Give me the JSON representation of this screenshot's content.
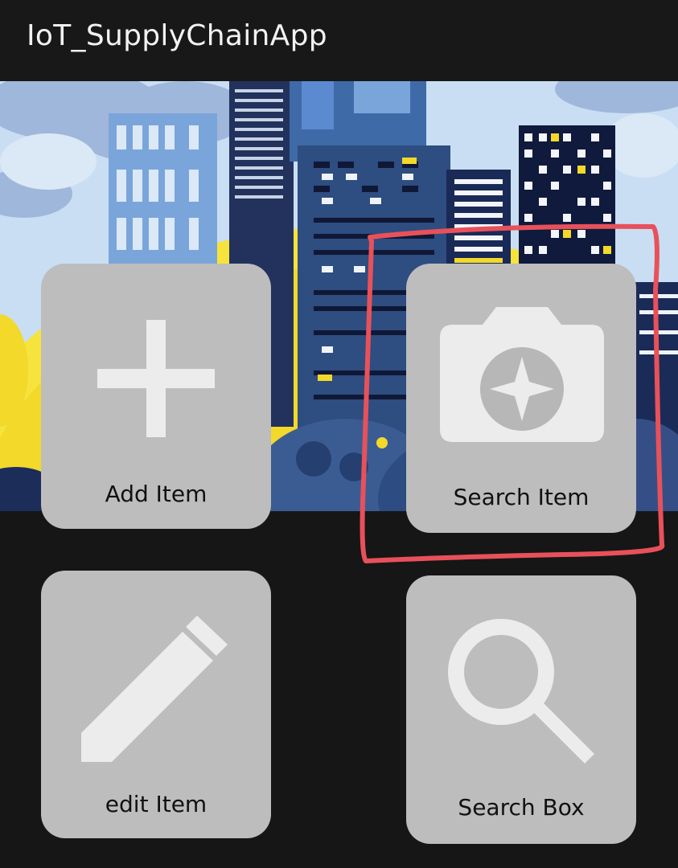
{
  "app": {
    "title": "IoT_SupplyChainApp"
  },
  "banner": {
    "description_icon": "city-skyline-illustration"
  },
  "tiles": [
    {
      "label": "Add Item",
      "icon": "plus-icon"
    },
    {
      "label": "Search Item",
      "icon": "camera-icon"
    },
    {
      "label": "edit Item",
      "icon": "pencil-icon"
    },
    {
      "label": "Search Box",
      "icon": "magnifier-icon"
    }
  ],
  "colors": {
    "background": "#161616",
    "tile": "#bdbdbd",
    "icon": "#ececec",
    "highlight": "#e8515a",
    "banner_sky": "#c9def3",
    "banner_yellow": "#f6e33c",
    "banner_navy": "#16244d"
  }
}
